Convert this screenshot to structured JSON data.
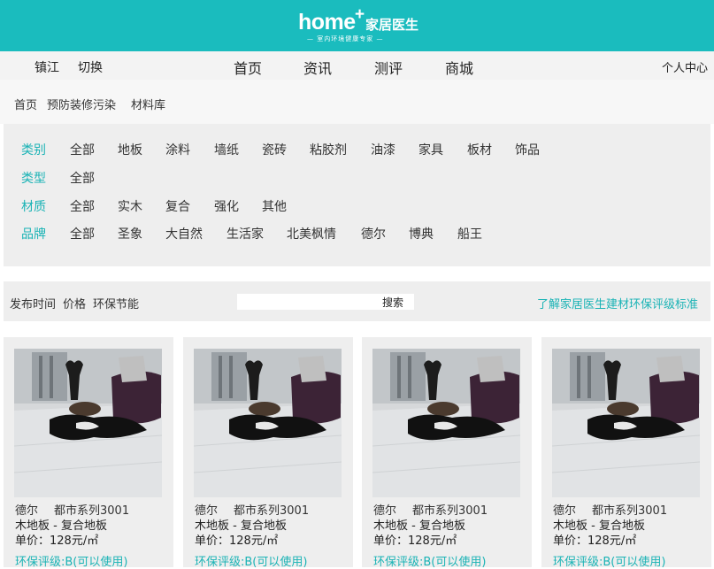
{
  "header": {
    "logo_home": "home",
    "logo_plus": "+",
    "logo_cn": "家居医生",
    "tagline": "— 室内环境健康专家 —"
  },
  "nav": {
    "city": "镇江",
    "switch": "切换",
    "menu": [
      "首页",
      "资讯",
      "测评",
      "商城"
    ],
    "user": "个人中心"
  },
  "breadcrumb": [
    "首页",
    "预防装修污染",
    "材料库"
  ],
  "filters": [
    {
      "label": "类别",
      "options": [
        "全部",
        "地板",
        "涂料",
        "墙纸",
        "瓷砖",
        "粘胶剂",
        "油漆",
        "家具",
        "板材",
        "饰品"
      ]
    },
    {
      "label": "类型",
      "options": [
        "全部"
      ]
    },
    {
      "label": "材质",
      "options": [
        "全部",
        "实木",
        "复合",
        "强化",
        "其他"
      ]
    },
    {
      "label": "品牌",
      "options": [
        "全部",
        "圣象",
        "大自然",
        "生活家",
        "北美枫情",
        "德尔",
        "博典",
        "船王"
      ]
    }
  ],
  "sort": {
    "items": [
      "发布时间",
      "价格",
      "环保节能"
    ],
    "search_button": "搜索",
    "standard_link": "了解家居医生建材环保评级标准"
  },
  "products": [
    {
      "brand": "德尔",
      "series": "都市系列3001",
      "name": "木地板 - 复合地板",
      "price": "单价：128元/㎡",
      "grade": "环保评级:B(可以使用)"
    },
    {
      "brand": "德尔",
      "series": "都市系列3001",
      "name": "木地板 - 复合地板",
      "price": "单价：128元/㎡",
      "grade": "环保评级:B(可以使用)"
    },
    {
      "brand": "德尔",
      "series": "都市系列3001",
      "name": "木地板 - 复合地板",
      "price": "单价：128元/㎡",
      "grade": "环保评级:B(可以使用)"
    },
    {
      "brand": "德尔",
      "series": "都市系列3001",
      "name": "木地板 - 复合地板",
      "price": "单价：128元/㎡",
      "grade": "环保评级:B(可以使用)"
    }
  ]
}
